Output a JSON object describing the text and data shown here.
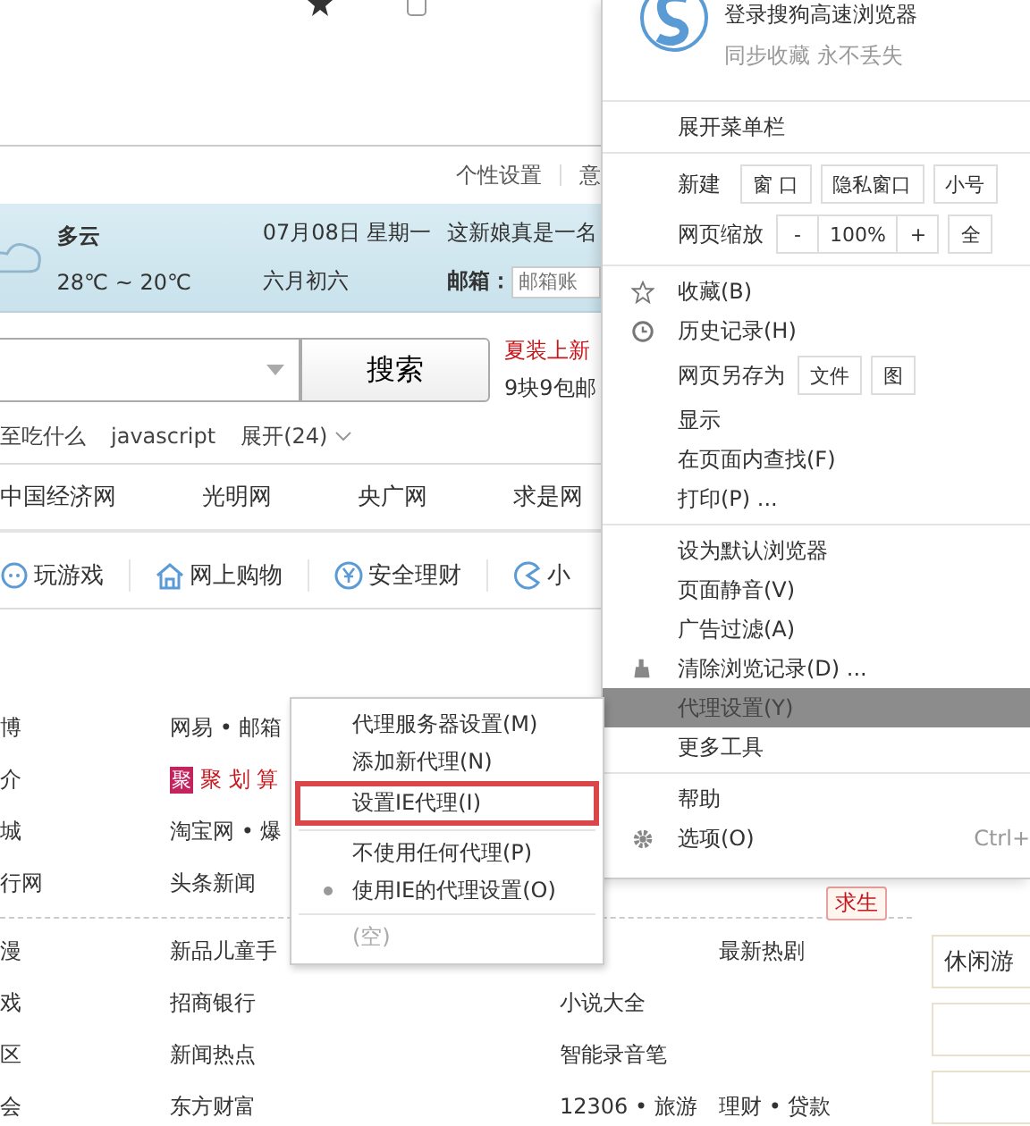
{
  "page": {
    "top_links": [
      "个性设置",
      "意"
    ],
    "weather": {
      "condition": "多云",
      "temperature": "28℃ ~ 20℃",
      "date": "07月08日 星期一",
      "lunar_date": "六月初六",
      "headline": "这新娘真是一名",
      "mail_label": "邮箱：",
      "mail_placeholder": "邮箱账"
    },
    "search": {
      "button": "搜索",
      "promo_title": "夏装上新",
      "promo_subtitle": "9块9包邮"
    },
    "hot_words": [
      "至吃什么",
      "javascript"
    ],
    "expand": "展开(24)",
    "site_links": [
      "中国经济网",
      "光明网",
      "央广网",
      "求是网"
    ],
    "categories": [
      "玩游戏",
      "网上购物",
      "安全理财",
      "小"
    ],
    "link_groups": [
      [
        {
          "col_1": "博",
          "col_2": "网易 • 邮箱"
        },
        {
          "col_1": "介",
          "col_2": "聚 划 算",
          "col_2_badge": "聚"
        },
        {
          "col_1": "城",
          "col_2": "淘宝网 • 爆"
        },
        {
          "col_1": "行网",
          "col_2": "头条新闻",
          "tag": "求生"
        }
      ],
      [
        {
          "col_1": "漫",
          "col_2": "新品儿童手",
          "col_4": "最新热剧"
        },
        {
          "col_1": "戏",
          "col_2": "招商银行",
          "col_3": "小说大全"
        },
        {
          "col_1": "区",
          "col_2": "新闻热点",
          "col_3": "智能录音笔"
        },
        {
          "col_1": "会",
          "col_2": "东方财富",
          "col_3": "12306 • 旅游",
          "col_4": "理财 • 贷款"
        }
      ]
    ],
    "cards": [
      "休闲游"
    ]
  },
  "menu": {
    "account": {
      "title": "登录搜狗高速浏览器",
      "subtitle": "同步收藏 永不丢失"
    },
    "sections": [
      [
        {
          "kind": "item",
          "label": "展开菜单栏",
          "selected": false
        }
      ],
      [
        {
          "kind": "buttons",
          "label": "新建",
          "groups": [
            [
              "窗 口"
            ],
            [
              "隐私窗口"
            ],
            [
              "小号"
            ]
          ]
        },
        {
          "kind": "buttons",
          "label": "网页缩放",
          "groups": [
            [
              "-",
              "100%",
              "+"
            ],
            [
              "全"
            ]
          ]
        }
      ],
      [
        {
          "kind": "star",
          "label": "收藏(B)",
          "selected": false
        },
        {
          "kind": "clock",
          "label": "历史记录(H)",
          "selected": false
        },
        {
          "kind": "buttons",
          "label": "网页另存为",
          "groups": [
            [
              "文件"
            ],
            [
              "图"
            ]
          ]
        },
        {
          "kind": "item",
          "label": "显示",
          "selected": false
        },
        {
          "kind": "item",
          "label": "在页面内查找(F)",
          "selected": false
        },
        {
          "kind": "item",
          "label": "打印(P) ...",
          "selected": false
        }
      ],
      [
        {
          "kind": "item",
          "label": "设为默认浏览器",
          "selected": false
        },
        {
          "kind": "item",
          "label": "页面静音(V)",
          "selected": false
        },
        {
          "kind": "item",
          "label": "广告过滤(A)",
          "selected": false
        },
        {
          "kind": "eraser",
          "label": "清除浏览记录(D) ...",
          "selected": false
        },
        {
          "kind": "item",
          "label": "代理设置(Y)",
          "selected": true
        },
        {
          "kind": "item",
          "label": "更多工具",
          "selected": false
        }
      ],
      [
        {
          "kind": "item",
          "label": "帮助",
          "selected": false
        },
        {
          "kind": "gear",
          "label": "选项(O)",
          "shortcut": "Ctrl+",
          "selected": false
        }
      ]
    ]
  },
  "submenu": {
    "sections": [
      [
        {
          "kind": "item",
          "label": "代理服务器设置(M)",
          "annotated": false
        },
        {
          "kind": "item",
          "label": "添加新代理(N)",
          "annotated": false
        },
        {
          "kind": "item",
          "label": "设置IE代理(I)",
          "annotated": true
        }
      ],
      [
        {
          "kind": "radio",
          "label": "不使用任何代理(P)",
          "checked": false,
          "annotated": false
        },
        {
          "kind": "radio",
          "label": "使用IE的代理设置(O)",
          "checked": true,
          "annotated": false
        }
      ],
      [
        {
          "kind": "empty",
          "label": "(空)",
          "annotated": false
        }
      ]
    ]
  }
}
